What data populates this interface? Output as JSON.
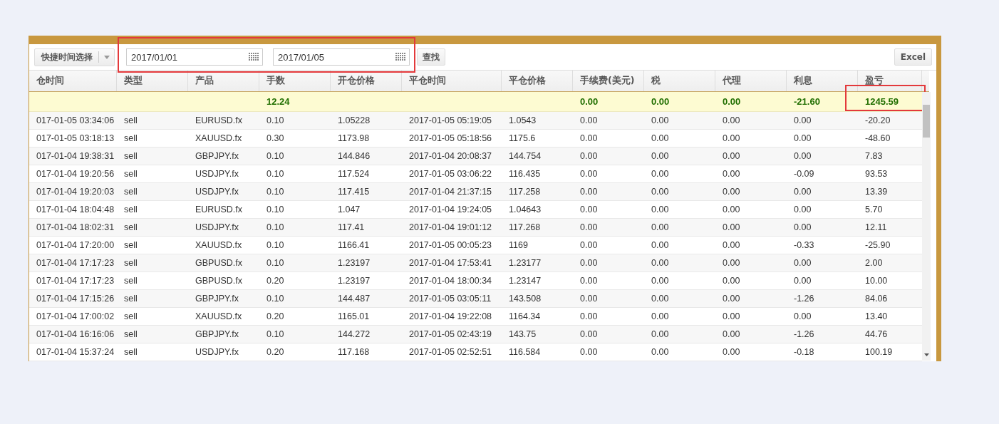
{
  "toolbar": {
    "quick_select": {
      "label": "快捷时间选择"
    },
    "date_range_highlighted": true,
    "start_date": {
      "value": "2017/01/01"
    },
    "end_date": {
      "value": "2017/01/05"
    },
    "search_button": "查找",
    "export_button": "Excel"
  },
  "table": {
    "columns": [
      "仓时间",
      "类型",
      "产品",
      "手数",
      "开仓价格",
      "平仓时间",
      "平仓价格",
      "手续费(美元)",
      "税",
      "代理",
      "利息",
      "盈亏"
    ],
    "summary": {
      "lots": {
        "value": "12.24",
        "highlighted": false
      },
      "commission": {
        "value": "0.00",
        "highlighted": false
      },
      "tax": {
        "value": "0.00",
        "highlighted": false
      },
      "agent": {
        "value": "0.00",
        "highlighted": false
      },
      "interest": {
        "value": "-21.60",
        "highlighted": false
      },
      "profit": {
        "value": "1245.59",
        "highlighted": true
      }
    },
    "rows": [
      [
        "017-01-05 03:34:06",
        "sell",
        "EURUSD.fx",
        "0.10",
        "1.05228",
        "2017-01-05 05:19:05",
        "1.0543",
        "0.00",
        "0.00",
        "0.00",
        "0.00",
        "-20.20"
      ],
      [
        "017-01-05 03:18:13",
        "sell",
        "XAUUSD.fx",
        "0.30",
        "1173.98",
        "2017-01-05 05:18:56",
        "1175.6",
        "0.00",
        "0.00",
        "0.00",
        "0.00",
        "-48.60"
      ],
      [
        "017-01-04 19:38:31",
        "sell",
        "GBPJPY.fx",
        "0.10",
        "144.846",
        "2017-01-04 20:08:37",
        "144.754",
        "0.00",
        "0.00",
        "0.00",
        "0.00",
        "7.83"
      ],
      [
        "017-01-04 19:20:56",
        "sell",
        "USDJPY.fx",
        "0.10",
        "117.524",
        "2017-01-05 03:06:22",
        "116.435",
        "0.00",
        "0.00",
        "0.00",
        "-0.09",
        "93.53"
      ],
      [
        "017-01-04 19:20:03",
        "sell",
        "USDJPY.fx",
        "0.10",
        "117.415",
        "2017-01-04 21:37:15",
        "117.258",
        "0.00",
        "0.00",
        "0.00",
        "0.00",
        "13.39"
      ],
      [
        "017-01-04 18:04:48",
        "sell",
        "EURUSD.fx",
        "0.10",
        "1.047",
        "2017-01-04 19:24:05",
        "1.04643",
        "0.00",
        "0.00",
        "0.00",
        "0.00",
        "5.70"
      ],
      [
        "017-01-04 18:02:31",
        "sell",
        "USDJPY.fx",
        "0.10",
        "117.41",
        "2017-01-04 19:01:12",
        "117.268",
        "0.00",
        "0.00",
        "0.00",
        "0.00",
        "12.11"
      ],
      [
        "017-01-04 17:20:00",
        "sell",
        "XAUUSD.fx",
        "0.10",
        "1166.41",
        "2017-01-05 00:05:23",
        "1169",
        "0.00",
        "0.00",
        "0.00",
        "-0.33",
        "-25.90"
      ],
      [
        "017-01-04 17:17:23",
        "sell",
        "GBPUSD.fx",
        "0.10",
        "1.23197",
        "2017-01-04 17:53:41",
        "1.23177",
        "0.00",
        "0.00",
        "0.00",
        "0.00",
        "2.00"
      ],
      [
        "017-01-04 17:17:23",
        "sell",
        "GBPUSD.fx",
        "0.20",
        "1.23197",
        "2017-01-04 18:00:34",
        "1.23147",
        "0.00",
        "0.00",
        "0.00",
        "0.00",
        "10.00"
      ],
      [
        "017-01-04 17:15:26",
        "sell",
        "GBPJPY.fx",
        "0.10",
        "144.487",
        "2017-01-05 03:05:11",
        "143.508",
        "0.00",
        "0.00",
        "0.00",
        "-1.26",
        "84.06"
      ],
      [
        "017-01-04 17:00:02",
        "sell",
        "XAUUSD.fx",
        "0.20",
        "1165.01",
        "2017-01-04 19:22:08",
        "1164.34",
        "0.00",
        "0.00",
        "0.00",
        "0.00",
        "13.40"
      ],
      [
        "017-01-04 16:16:06",
        "sell",
        "GBPJPY.fx",
        "0.10",
        "144.272",
        "2017-01-05 02:43:19",
        "143.75",
        "0.00",
        "0.00",
        "0.00",
        "-1.26",
        "44.76"
      ],
      [
        "017-01-04 15:37:24",
        "sell",
        "USDJPY.fx",
        "0.20",
        "117.168",
        "2017-01-05 02:52:51",
        "116.584",
        "0.00",
        "0.00",
        "0.00",
        "-0.18",
        "100.19"
      ]
    ]
  }
}
